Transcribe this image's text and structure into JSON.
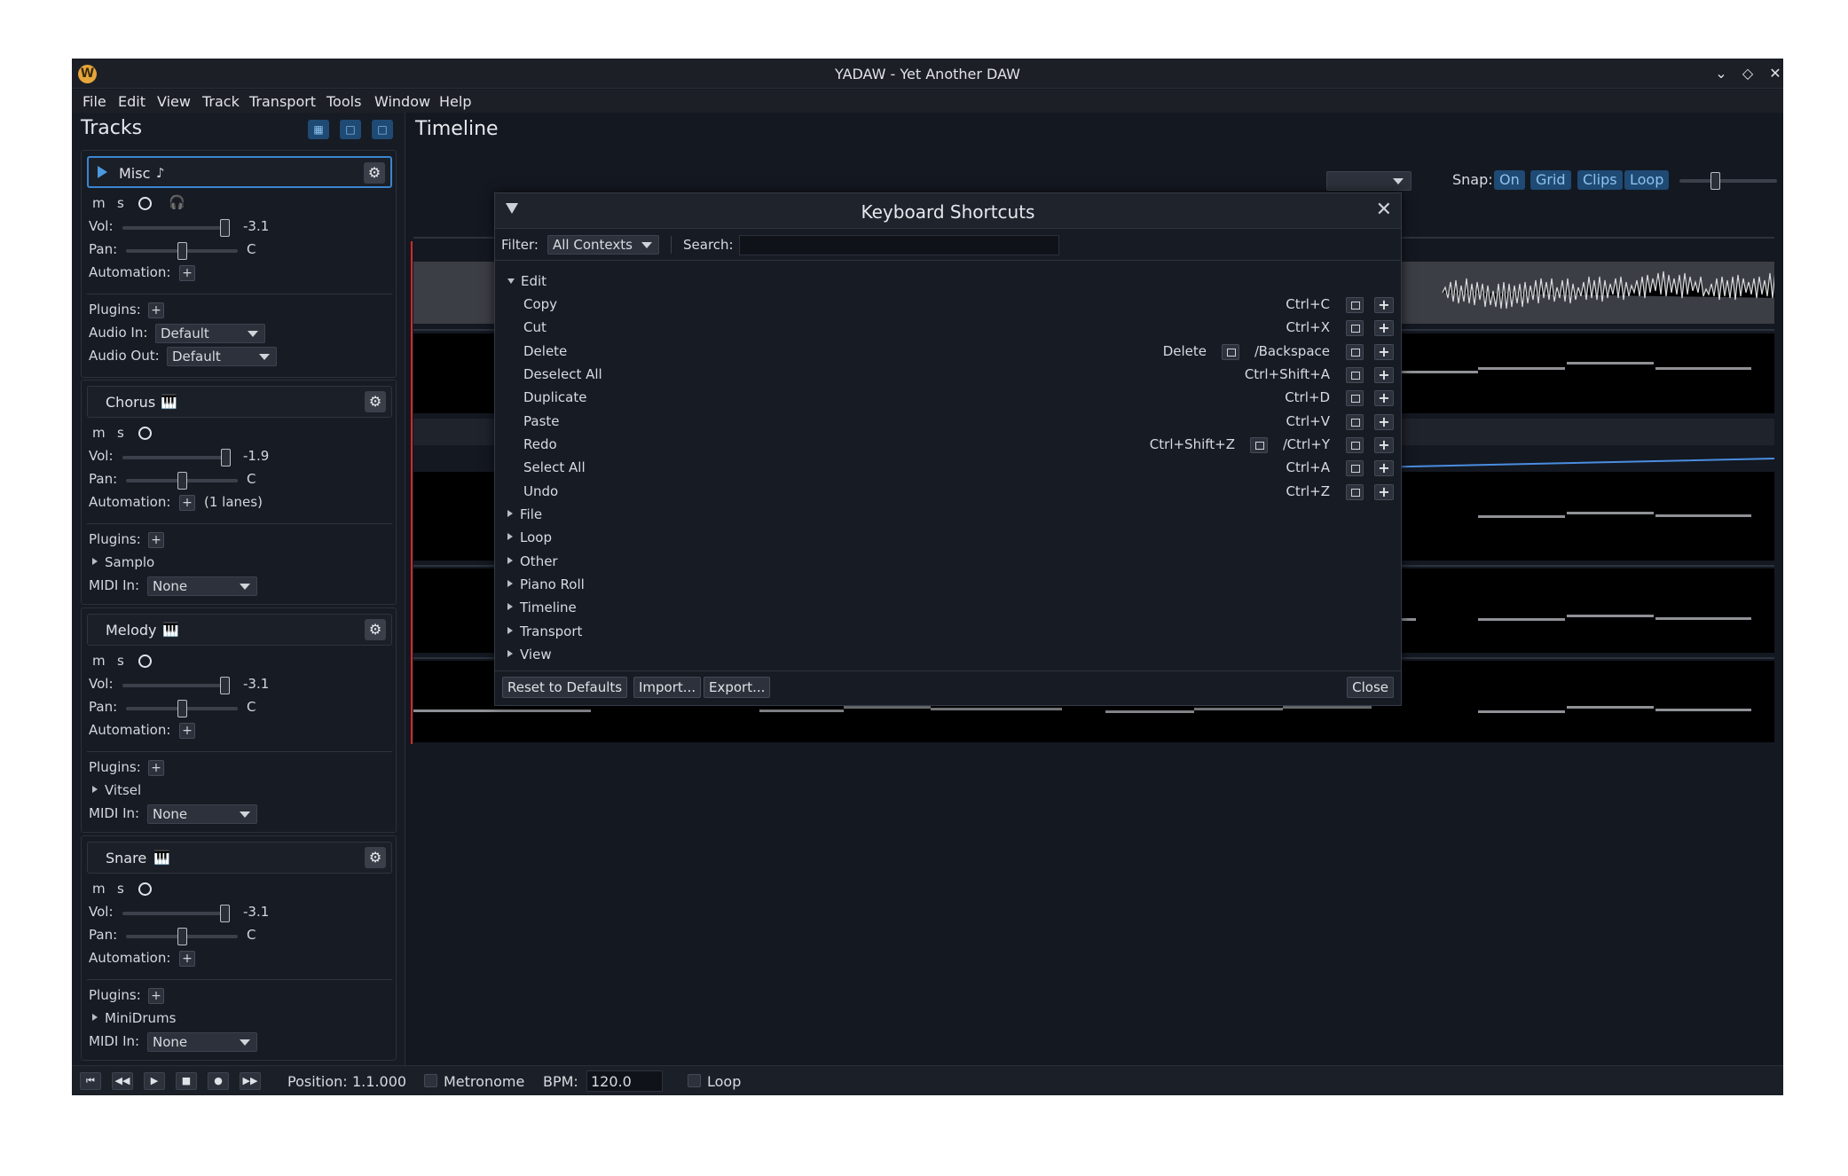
{
  "window": {
    "title": "YADAW - Yet Another DAW",
    "app_icon": "W"
  },
  "menu": [
    "File",
    "Edit",
    "View",
    "Track",
    "Transport",
    "Tools",
    "Window",
    "Help"
  ],
  "tracks_panel": {
    "title": "Tracks"
  },
  "tracks": [
    {
      "name": "Misc",
      "vol": "-3.1",
      "pan": "C",
      "automation_extra": "",
      "plugins": [],
      "audio_in": "Default",
      "audio_out": "Default"
    },
    {
      "name": "Chorus",
      "vol": "-1.9",
      "pan": "C",
      "automation_extra": "(1 lanes)",
      "plugins": [
        "Samplo"
      ],
      "midi_in": "None"
    },
    {
      "name": "Melody",
      "vol": "-3.1",
      "pan": "C",
      "automation_extra": "",
      "plugins": [
        "Vitsel"
      ],
      "midi_in": "None"
    },
    {
      "name": "Snare",
      "vol": "-3.1",
      "pan": "C",
      "automation_extra": "",
      "plugins": [
        "MiniDrums"
      ],
      "midi_in": "None"
    }
  ],
  "labels": {
    "m": "m",
    "s": "s",
    "vol": "Vol:",
    "pan": "Pan:",
    "automation": "Automation:",
    "plugins": "Plugins:",
    "audio_in": "Audio In:",
    "audio_out": "Audio Out:",
    "midi_in": "MIDI In:"
  },
  "timeline": {
    "title": "Timeline",
    "snap_label": "Snap:",
    "snap_buttons": [
      "On",
      "Grid",
      "Clips",
      "Loop"
    ]
  },
  "transport": {
    "position_label": "Position:",
    "position": "1.1.000",
    "metronome": "Metronome",
    "bpm_label": "BPM:",
    "bpm": "120.0",
    "loop": "Loop"
  },
  "dialog": {
    "title": "Keyboard Shortcuts",
    "filter_label": "Filter:",
    "filter_value": "All Contexts",
    "search_label": "Search:",
    "search_value": "",
    "expanded_group": "Edit",
    "items": [
      {
        "name": "Copy",
        "keys": [
          "Ctrl+C"
        ]
      },
      {
        "name": "Cut",
        "keys": [
          "Ctrl+X"
        ]
      },
      {
        "name": "Delete",
        "keys": [
          "Delete",
          "Backspace"
        ]
      },
      {
        "name": "Deselect All",
        "keys": [
          "Ctrl+Shift+A"
        ]
      },
      {
        "name": "Duplicate",
        "keys": [
          "Ctrl+D"
        ]
      },
      {
        "name": "Paste",
        "keys": [
          "Ctrl+V"
        ]
      },
      {
        "name": "Redo",
        "keys": [
          "Ctrl+Shift+Z",
          "Ctrl+Y"
        ]
      },
      {
        "name": "Select All",
        "keys": [
          "Ctrl+A"
        ]
      },
      {
        "name": "Undo",
        "keys": [
          "Ctrl+Z"
        ]
      }
    ],
    "key_separator": "/",
    "collapsed_groups": [
      "File",
      "Loop",
      "Other",
      "Piano Roll",
      "Timeline",
      "Transport",
      "View"
    ],
    "buttons": {
      "reset": "Reset to Defaults",
      "import": "Import...",
      "export": "Export...",
      "close": "Close"
    }
  },
  "colors": {
    "accent": "#3a86cf",
    "playhead": "#d02a2a",
    "background": "#141821"
  }
}
